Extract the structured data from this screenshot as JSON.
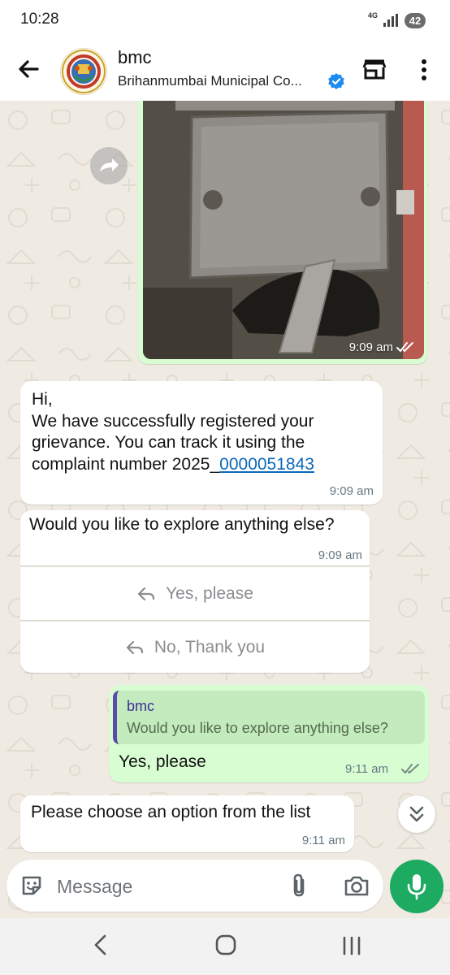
{
  "status_bar": {
    "time": "10:28",
    "network": "4G",
    "battery": "42"
  },
  "header": {
    "title": "bmc",
    "subtitle": "Brihanmumbai Municipal Co...",
    "verified": true
  },
  "messages": {
    "image": {
      "time": "9:09 am"
    },
    "registered": {
      "line1": "Hi,",
      "line2": "We have successfully registered your",
      "line3": "grievance. You can track it using the",
      "line4_prefix": "complaint number 2025_",
      "complaint_link": "0000051843",
      "time": "9:09 am"
    },
    "explore": {
      "text": "Would you like to explore anything else?",
      "time": "9:09 am",
      "buttons": [
        "Yes, please",
        "No, Thank you"
      ]
    },
    "reply": {
      "quoted_author": "bmc",
      "quoted_text": "Would you like to explore anything else?",
      "text": "Yes, please",
      "time": "9:11 am"
    },
    "choose": {
      "text": "Please choose an option from the list",
      "time": "9:11 am"
    }
  },
  "input": {
    "placeholder": "Message"
  },
  "colors": {
    "bubble_out": "#d9fdd3",
    "bubble_in": "#ffffff",
    "accent_green": "#1daa61",
    "link": "#0b68b8",
    "read_ticks": "#53bdeb"
  },
  "icons": [
    "back-arrow-icon",
    "bmc-logo",
    "verified-badge-icon",
    "shop-icon",
    "more-menu-icon",
    "forward-icon",
    "double-check-icon",
    "reply-arrow-icon",
    "scroll-down-icon",
    "sticker-icon",
    "attach-icon",
    "camera-icon",
    "mic-icon",
    "nav-back-icon",
    "nav-home-icon",
    "nav-recents-icon"
  ]
}
